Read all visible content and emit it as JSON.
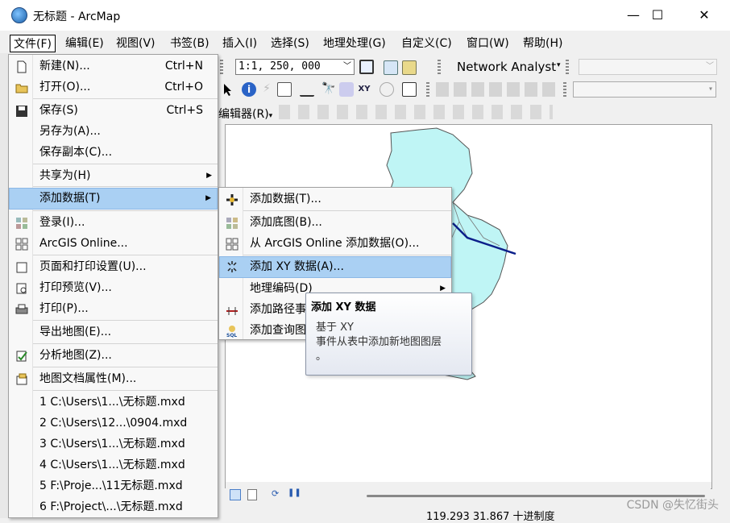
{
  "window": {
    "title": "无标题 - ArcMap",
    "minimize": "—",
    "maximize": "☐",
    "close": "✕"
  },
  "menubar": [
    "文件(F)",
    "编辑(E)",
    "视图(V)",
    "书签(B)",
    "插入(I)",
    "选择(S)",
    "地理处理(G)",
    "自定义(C)",
    "窗口(W)",
    "帮助(H)"
  ],
  "toolbar": {
    "scale": "1:1, 250, 000",
    "network_analyst": "Network Analyst",
    "editor": "编辑器(R)"
  },
  "file_menu": [
    {
      "label": "新建(N)...",
      "shortcut": "Ctrl+N",
      "icon": "new-document-icon"
    },
    {
      "label": "打开(O)...",
      "shortcut": "Ctrl+O",
      "icon": "open-folder-icon"
    },
    {
      "label": "保存(S)",
      "shortcut": "Ctrl+S",
      "icon": "save-icon"
    },
    {
      "label": "另存为(A)...",
      "shortcut": ""
    },
    {
      "label": "保存副本(C)...",
      "shortcut": ""
    },
    {
      "label": "共享为(H)",
      "shortcut": "",
      "submenu": true
    },
    {
      "label": "添加数据(T)",
      "shortcut": "",
      "submenu": true,
      "highlighted": true
    },
    {
      "label": "登录(I)...",
      "shortcut": "",
      "icon": "sign-in-icon"
    },
    {
      "label": "ArcGIS Online...",
      "shortcut": "",
      "icon": "arcgis-online-icon"
    },
    {
      "label": "页面和打印设置(U)...",
      "shortcut": "",
      "icon": "page-setup-icon"
    },
    {
      "label": "打印预览(V)...",
      "shortcut": "",
      "icon": "print-preview-icon"
    },
    {
      "label": "打印(P)...",
      "shortcut": "",
      "icon": "print-icon"
    },
    {
      "label": "导出地图(E)...",
      "shortcut": ""
    },
    {
      "label": "分析地图(Z)...",
      "shortcut": "",
      "icon": "analyze-map-icon"
    },
    {
      "label": "地图文档属性(M)...",
      "shortcut": "",
      "icon": "map-properties-icon"
    },
    {
      "label": "1 C:\\Users\\1...\\无标题.mxd",
      "shortcut": ""
    },
    {
      "label": "2 C:\\Users\\12...\\0904.mxd",
      "shortcut": ""
    },
    {
      "label": "3 C:\\Users\\1...\\无标题.mxd",
      "shortcut": ""
    },
    {
      "label": "4 C:\\Users\\1...\\无标题.mxd",
      "shortcut": ""
    },
    {
      "label": "5 F:\\Proje...\\11无标题.mxd",
      "shortcut": ""
    },
    {
      "label": "6 F:\\Project\\...\\无标题.mxd",
      "shortcut": ""
    }
  ],
  "add_data_submenu": [
    {
      "label": "添加数据(T)...",
      "icon": "add-data-icon"
    },
    {
      "label": "添加底图(B)...",
      "icon": "basemap-icon"
    },
    {
      "label": "从 ArcGIS Online 添加数据(O)...",
      "icon": "arcgis-online-icon"
    },
    {
      "label": "添加 XY 数据(A)...",
      "icon": "add-xy-icon",
      "highlighted": true
    },
    {
      "label": "地理编码(D)",
      "submenu": true
    },
    {
      "label": "添加路径事",
      "icon": "route-event-icon"
    },
    {
      "label": "添加查询图",
      "icon": "sql-query-icon"
    }
  ],
  "tooltip": {
    "title": "添加 XY 数据",
    "line1": "基于 XY",
    "line2": "事件从表中添加新地图图层",
    "line3": "。"
  },
  "status": {
    "coords": "119.293  31.867 十进制度"
  },
  "watermark": "CSDN @失忆街头",
  "colors": {
    "highlight": "#aad0f3",
    "map_polygon": "#bff5f5",
    "route_line": "#0b1f8a"
  }
}
